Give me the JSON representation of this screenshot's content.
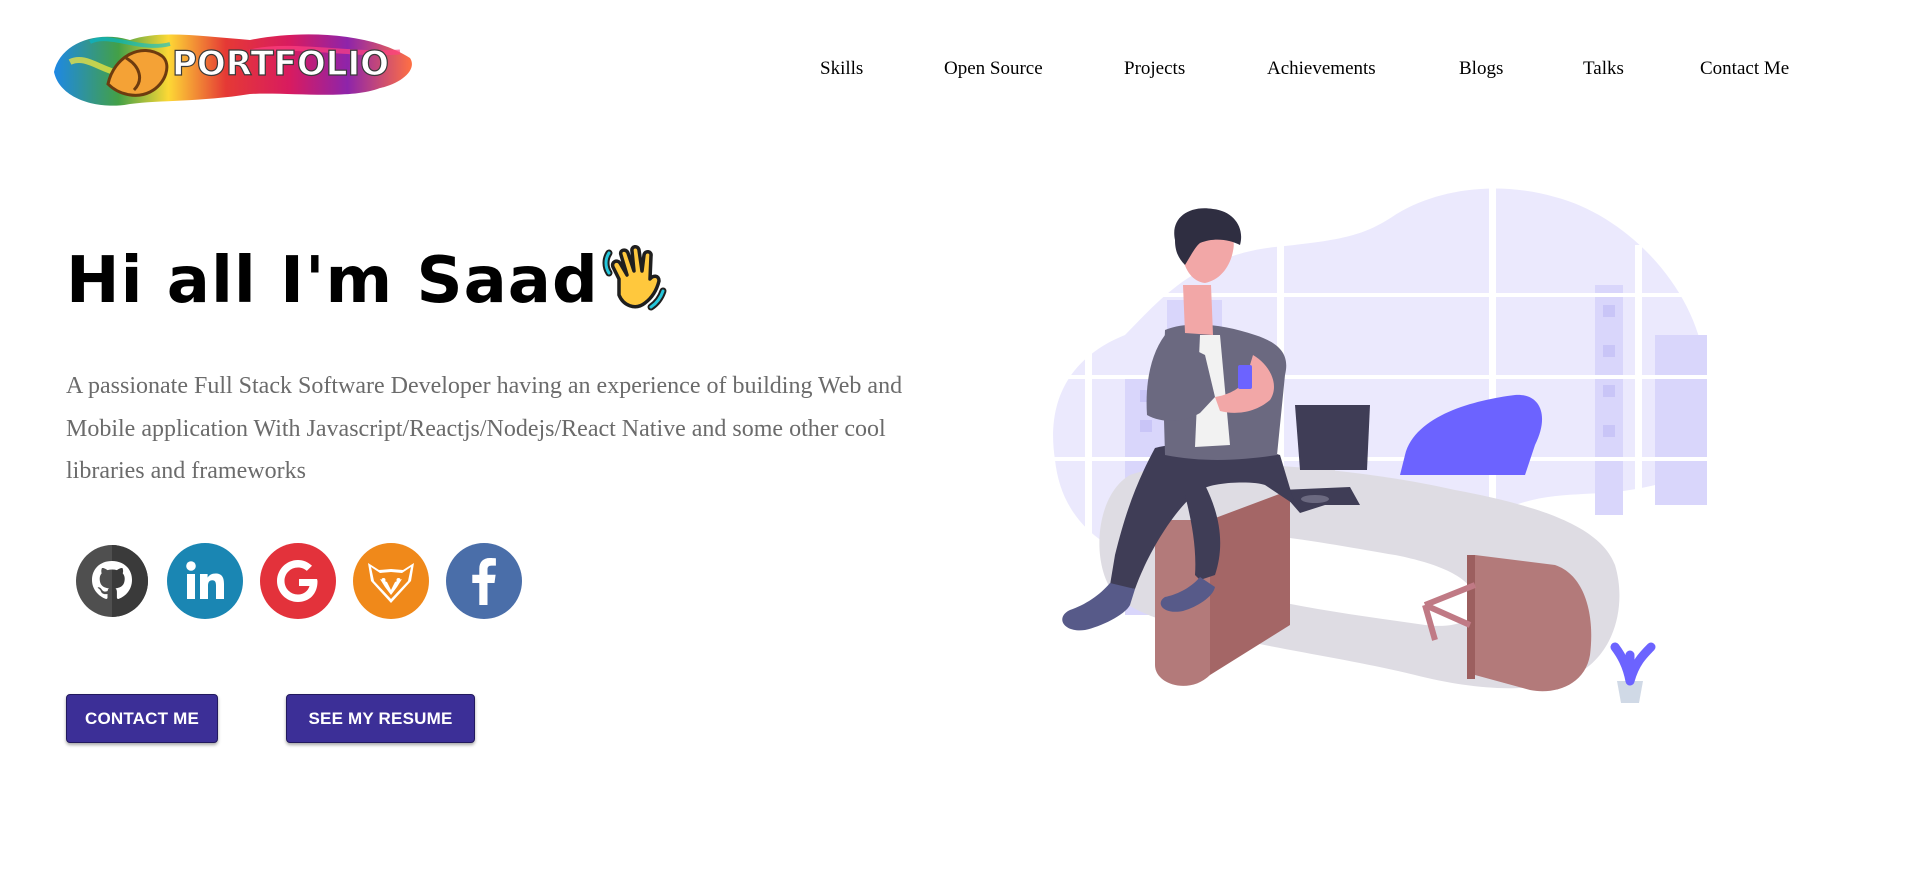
{
  "header": {
    "logo_text": "PORTFOLIO",
    "nav": [
      {
        "label": "Skills"
      },
      {
        "label": "Open Source"
      },
      {
        "label": "Projects"
      },
      {
        "label": "Achievements"
      },
      {
        "label": "Blogs"
      },
      {
        "label": "Talks"
      },
      {
        "label": "Contact Me"
      }
    ]
  },
  "hero": {
    "greeting": "Hi all I'm Saad",
    "wave_icon": "waving-hand-emoji",
    "intro": "A passionate Full Stack Software Developer having an experience of building Web and Mobile application With Javascript/Reactjs/Nodejs/React Native and some other cool libraries and frameworks",
    "socials": [
      {
        "name": "github",
        "icon": "github-icon",
        "color": "#333333"
      },
      {
        "name": "linkedin",
        "icon": "linkedin-icon",
        "color": "#0e76a8"
      },
      {
        "name": "google",
        "icon": "google-icon",
        "color": "#ea4335"
      },
      {
        "name": "gitlab",
        "icon": "gitlab-fox-icon",
        "color": "#fca326"
      },
      {
        "name": "facebook",
        "icon": "facebook-icon",
        "color": "#3b5998"
      }
    ],
    "buttons": {
      "contact": "CONTACT ME",
      "resume": "SEE MY RESUME"
    }
  },
  "colors": {
    "button_bg": "#3c2f97",
    "intro_text": "#6b6b6b",
    "illustration_accent": "#6c63ff"
  }
}
